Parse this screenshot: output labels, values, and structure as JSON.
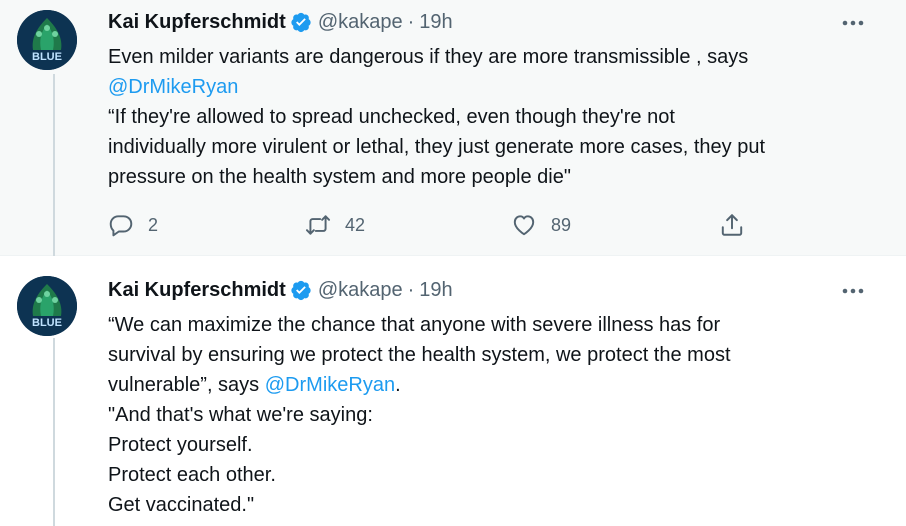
{
  "tweets": [
    {
      "author": "Kai Kupferschmidt",
      "handle": "@kakape",
      "separator": "·",
      "time": "19h",
      "avatar_text": "BLUE",
      "body": [
        {
          "text": "Even milder variants are dangerous if they are more transmissible , says "
        },
        {
          "mention": "@DrMikeRyan"
        },
        {
          "text": "“If they're allowed to spread unchecked, even though they're not"
        },
        {
          "text": "individually more virulent or lethal, they just generate more cases, they put"
        },
        {
          "text": "pressure on the health system and more people die\""
        }
      ],
      "actions": {
        "replies": "2",
        "retweets": "42",
        "likes": "89"
      }
    },
    {
      "author": "Kai Kupferschmidt",
      "handle": "@kakape",
      "separator": "·",
      "time": "19h",
      "avatar_text": "BLUE",
      "body": [
        {
          "text": "“We can maximize the chance that anyone with severe illness has for"
        },
        {
          "text": "survival by ensuring we protect the health system, we protect the most"
        },
        {
          "text_before": "vulnerable”, says ",
          "mention": "@DrMikeRyan",
          "text_after": "."
        },
        {
          "text": "\"And that's what we're saying:"
        },
        {
          "text": "Protect yourself."
        },
        {
          "text": "Protect each other."
        },
        {
          "text": "Get vaccinated.\""
        }
      ]
    }
  ],
  "colors": {
    "accent": "#1d9bf0",
    "muted": "#536471",
    "text": "#0f1419",
    "verified": "#1d9bf0"
  },
  "icons": [
    "verified-badge-icon",
    "more-icon",
    "reply-icon",
    "retweet-icon",
    "like-icon",
    "share-icon"
  ]
}
